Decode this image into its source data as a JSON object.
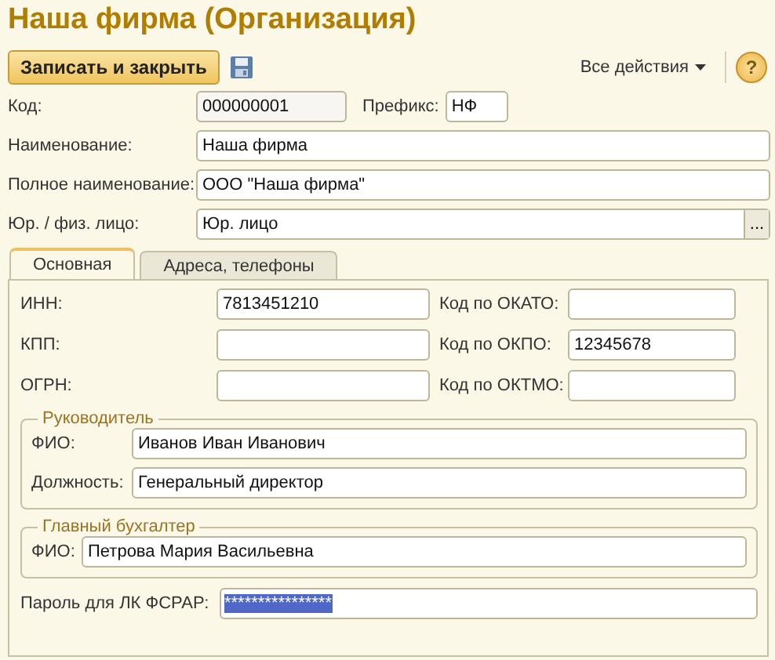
{
  "window": {
    "title": "Наша фирма (Организация)"
  },
  "toolbar": {
    "save_close": "Записать и закрыть",
    "all_actions": "Все действия",
    "help": "?"
  },
  "header": {
    "code": {
      "label": "Код:",
      "value": "000000001"
    },
    "prefix": {
      "label": "Префикс:",
      "value": "НФ"
    },
    "rows": [
      {
        "label": "Наименование:",
        "value": "Наша фирма",
        "kind": "text"
      },
      {
        "label": "Полное наименование:",
        "value": "ООО \"Наша фирма\"",
        "kind": "text"
      },
      {
        "label": "Юр. / физ. лицо:",
        "value": "Юр. лицо",
        "kind": "choice",
        "choice_button": "..."
      }
    ]
  },
  "tabs": [
    {
      "label": "Основная",
      "selected": true
    },
    {
      "label": "Адреса, телефоны",
      "selected": false
    }
  ],
  "main": {
    "rows": [
      {
        "left_label": "ИНН:",
        "left_value": "7813451210",
        "right_label": "Код по ОКАТО:"
      },
      {
        "left_label": "КПП:",
        "right_label": "Код по ОКПО:",
        "right_value": "12345678"
      },
      {
        "left_label": "ОГРН:",
        "right_label": "Код по ОКТМО:"
      }
    ],
    "director": {
      "title": "Руководитель",
      "fields": [
        {
          "label": "ФИО:",
          "value": "Иванов Иван Иванович"
        },
        {
          "label": "Должность:",
          "value": "Генеральный директор"
        }
      ]
    },
    "accountant": {
      "title": "Главный бухгалтер",
      "fields": [
        {
          "label": "ФИО:",
          "value": "Петрова Мария Васильевна"
        }
      ]
    },
    "password": {
      "label": "Пароль для ЛК ФСРАР:",
      "value": "****************",
      "selected": true
    }
  }
}
